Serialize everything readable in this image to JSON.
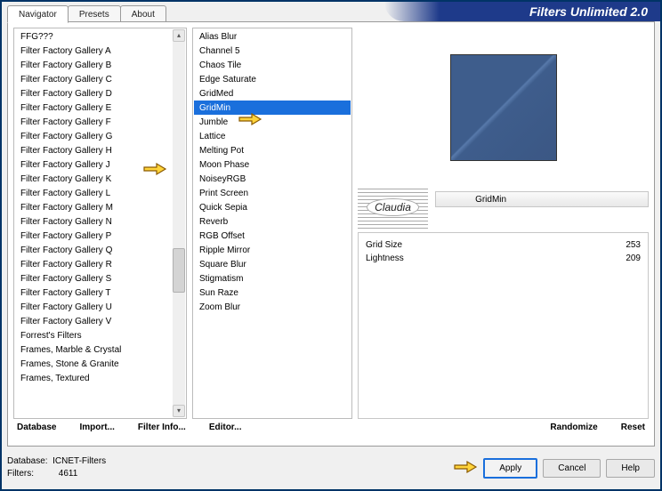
{
  "title": "Filters Unlimited 2.0",
  "tabs": [
    "Navigator",
    "Presets",
    "About"
  ],
  "active_tab": 0,
  "categories": {
    "items": [
      "FFG???",
      "Filter Factory Gallery A",
      "Filter Factory Gallery B",
      "Filter Factory Gallery C",
      "Filter Factory Gallery D",
      "Filter Factory Gallery E",
      "Filter Factory Gallery F",
      "Filter Factory Gallery G",
      "Filter Factory Gallery H",
      "Filter Factory Gallery J",
      "Filter Factory Gallery K",
      "Filter Factory Gallery L",
      "Filter Factory Gallery M",
      "Filter Factory Gallery N",
      "Filter Factory Gallery P",
      "Filter Factory Gallery Q",
      "Filter Factory Gallery R",
      "Filter Factory Gallery S",
      "Filter Factory Gallery T",
      "Filter Factory Gallery U",
      "Filter Factory Gallery V",
      "Forrest's Filters",
      "Frames, Marble & Crystal",
      "Frames, Stone & Granite",
      "Frames, Textured"
    ],
    "highlighted_index": 8
  },
  "filters": {
    "items": [
      "Alias Blur",
      "Channel 5",
      "Chaos Tile",
      "Edge Saturate",
      "GridMed",
      "GridMin",
      "Jumble",
      "Lattice",
      "Melting Pot",
      "Moon Phase",
      "NoiseyRGB",
      "Print Screen",
      "Quick Sepia",
      "Reverb",
      "RGB Offset",
      "Ripple Mirror",
      "Square Blur",
      "Stigmatism",
      "Sun Raze",
      "Zoom Blur"
    ],
    "selected_index": 5
  },
  "watermark": "Claudia",
  "current_filter": {
    "name": "GridMin",
    "params": [
      {
        "label": "Grid Size",
        "value": 253
      },
      {
        "label": "Lightness",
        "value": 209
      }
    ]
  },
  "toolbar": {
    "database": "Database",
    "import": "Import...",
    "filter_info": "Filter Info...",
    "editor": "Editor...",
    "randomize": "Randomize",
    "reset": "Reset"
  },
  "status": {
    "db_label": "Database:",
    "db_value": "ICNET-Filters",
    "filters_label": "Filters:",
    "filters_value": "4611"
  },
  "buttons": {
    "apply": "Apply",
    "cancel": "Cancel",
    "help": "Help"
  }
}
